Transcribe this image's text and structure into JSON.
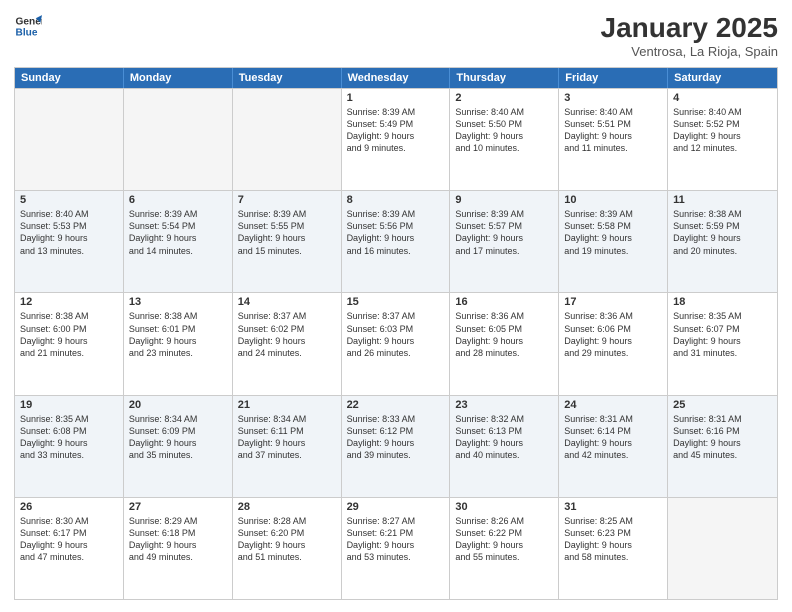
{
  "logo": {
    "line1": "General",
    "line2": "Blue"
  },
  "title": "January 2025",
  "subtitle": "Ventrosa, La Rioja, Spain",
  "days_of_week": [
    "Sunday",
    "Monday",
    "Tuesday",
    "Wednesday",
    "Thursday",
    "Friday",
    "Saturday"
  ],
  "rows": [
    [
      {
        "day": "",
        "lines": [],
        "empty": true
      },
      {
        "day": "",
        "lines": [],
        "empty": true
      },
      {
        "day": "",
        "lines": [],
        "empty": true
      },
      {
        "day": "1",
        "lines": [
          "Sunrise: 8:39 AM",
          "Sunset: 5:49 PM",
          "Daylight: 9 hours",
          "and 9 minutes."
        ]
      },
      {
        "day": "2",
        "lines": [
          "Sunrise: 8:40 AM",
          "Sunset: 5:50 PM",
          "Daylight: 9 hours",
          "and 10 minutes."
        ]
      },
      {
        "day": "3",
        "lines": [
          "Sunrise: 8:40 AM",
          "Sunset: 5:51 PM",
          "Daylight: 9 hours",
          "and 11 minutes."
        ]
      },
      {
        "day": "4",
        "lines": [
          "Sunrise: 8:40 AM",
          "Sunset: 5:52 PM",
          "Daylight: 9 hours",
          "and 12 minutes."
        ]
      }
    ],
    [
      {
        "day": "5",
        "lines": [
          "Sunrise: 8:40 AM",
          "Sunset: 5:53 PM",
          "Daylight: 9 hours",
          "and 13 minutes."
        ]
      },
      {
        "day": "6",
        "lines": [
          "Sunrise: 8:39 AM",
          "Sunset: 5:54 PM",
          "Daylight: 9 hours",
          "and 14 minutes."
        ]
      },
      {
        "day": "7",
        "lines": [
          "Sunrise: 8:39 AM",
          "Sunset: 5:55 PM",
          "Daylight: 9 hours",
          "and 15 minutes."
        ]
      },
      {
        "day": "8",
        "lines": [
          "Sunrise: 8:39 AM",
          "Sunset: 5:56 PM",
          "Daylight: 9 hours",
          "and 16 minutes."
        ]
      },
      {
        "day": "9",
        "lines": [
          "Sunrise: 8:39 AM",
          "Sunset: 5:57 PM",
          "Daylight: 9 hours",
          "and 17 minutes."
        ]
      },
      {
        "day": "10",
        "lines": [
          "Sunrise: 8:39 AM",
          "Sunset: 5:58 PM",
          "Daylight: 9 hours",
          "and 19 minutes."
        ]
      },
      {
        "day": "11",
        "lines": [
          "Sunrise: 8:38 AM",
          "Sunset: 5:59 PM",
          "Daylight: 9 hours",
          "and 20 minutes."
        ]
      }
    ],
    [
      {
        "day": "12",
        "lines": [
          "Sunrise: 8:38 AM",
          "Sunset: 6:00 PM",
          "Daylight: 9 hours",
          "and 21 minutes."
        ]
      },
      {
        "day": "13",
        "lines": [
          "Sunrise: 8:38 AM",
          "Sunset: 6:01 PM",
          "Daylight: 9 hours",
          "and 23 minutes."
        ]
      },
      {
        "day": "14",
        "lines": [
          "Sunrise: 8:37 AM",
          "Sunset: 6:02 PM",
          "Daylight: 9 hours",
          "and 24 minutes."
        ]
      },
      {
        "day": "15",
        "lines": [
          "Sunrise: 8:37 AM",
          "Sunset: 6:03 PM",
          "Daylight: 9 hours",
          "and 26 minutes."
        ]
      },
      {
        "day": "16",
        "lines": [
          "Sunrise: 8:36 AM",
          "Sunset: 6:05 PM",
          "Daylight: 9 hours",
          "and 28 minutes."
        ]
      },
      {
        "day": "17",
        "lines": [
          "Sunrise: 8:36 AM",
          "Sunset: 6:06 PM",
          "Daylight: 9 hours",
          "and 29 minutes."
        ]
      },
      {
        "day": "18",
        "lines": [
          "Sunrise: 8:35 AM",
          "Sunset: 6:07 PM",
          "Daylight: 9 hours",
          "and 31 minutes."
        ]
      }
    ],
    [
      {
        "day": "19",
        "lines": [
          "Sunrise: 8:35 AM",
          "Sunset: 6:08 PM",
          "Daylight: 9 hours",
          "and 33 minutes."
        ]
      },
      {
        "day": "20",
        "lines": [
          "Sunrise: 8:34 AM",
          "Sunset: 6:09 PM",
          "Daylight: 9 hours",
          "and 35 minutes."
        ]
      },
      {
        "day": "21",
        "lines": [
          "Sunrise: 8:34 AM",
          "Sunset: 6:11 PM",
          "Daylight: 9 hours",
          "and 37 minutes."
        ]
      },
      {
        "day": "22",
        "lines": [
          "Sunrise: 8:33 AM",
          "Sunset: 6:12 PM",
          "Daylight: 9 hours",
          "and 39 minutes."
        ]
      },
      {
        "day": "23",
        "lines": [
          "Sunrise: 8:32 AM",
          "Sunset: 6:13 PM",
          "Daylight: 9 hours",
          "and 40 minutes."
        ]
      },
      {
        "day": "24",
        "lines": [
          "Sunrise: 8:31 AM",
          "Sunset: 6:14 PM",
          "Daylight: 9 hours",
          "and 42 minutes."
        ]
      },
      {
        "day": "25",
        "lines": [
          "Sunrise: 8:31 AM",
          "Sunset: 6:16 PM",
          "Daylight: 9 hours",
          "and 45 minutes."
        ]
      }
    ],
    [
      {
        "day": "26",
        "lines": [
          "Sunrise: 8:30 AM",
          "Sunset: 6:17 PM",
          "Daylight: 9 hours",
          "and 47 minutes."
        ]
      },
      {
        "day": "27",
        "lines": [
          "Sunrise: 8:29 AM",
          "Sunset: 6:18 PM",
          "Daylight: 9 hours",
          "and 49 minutes."
        ]
      },
      {
        "day": "28",
        "lines": [
          "Sunrise: 8:28 AM",
          "Sunset: 6:20 PM",
          "Daylight: 9 hours",
          "and 51 minutes."
        ]
      },
      {
        "day": "29",
        "lines": [
          "Sunrise: 8:27 AM",
          "Sunset: 6:21 PM",
          "Daylight: 9 hours",
          "and 53 minutes."
        ]
      },
      {
        "day": "30",
        "lines": [
          "Sunrise: 8:26 AM",
          "Sunset: 6:22 PM",
          "Daylight: 9 hours",
          "and 55 minutes."
        ]
      },
      {
        "day": "31",
        "lines": [
          "Sunrise: 8:25 AM",
          "Sunset: 6:23 PM",
          "Daylight: 9 hours",
          "and 58 minutes."
        ]
      },
      {
        "day": "",
        "lines": [],
        "empty": true
      }
    ]
  ]
}
